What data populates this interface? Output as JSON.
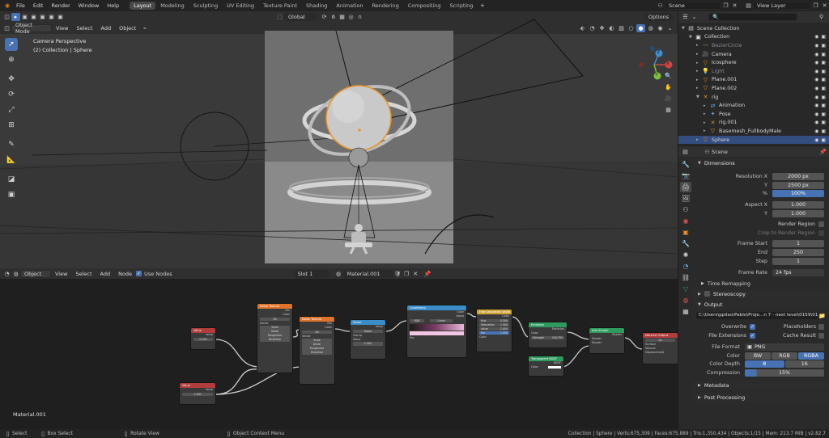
{
  "topbar": {
    "menus": [
      "File",
      "Edit",
      "Render",
      "Window",
      "Help"
    ],
    "workspaces": [
      {
        "label": "Layout",
        "active": true
      },
      {
        "label": "Modeling",
        "active": false
      },
      {
        "label": "Sculpting",
        "active": false
      },
      {
        "label": "UV Editing",
        "active": false
      },
      {
        "label": "Texture Paint",
        "active": false
      },
      {
        "label": "Shading",
        "active": false
      },
      {
        "label": "Animation",
        "active": false
      },
      {
        "label": "Rendering",
        "active": false
      },
      {
        "label": "Compositing",
        "active": false
      },
      {
        "label": "Scripting",
        "active": false
      }
    ],
    "scene": "Scene",
    "view_layer": "View Layer"
  },
  "viewport_header": {
    "transform_orientation": "Global",
    "options": "Options"
  },
  "viewport": {
    "mode": "Object Mode",
    "menus": [
      "View",
      "Select",
      "Add",
      "Object"
    ],
    "camera_label": "Camera Perspective",
    "object_label": "(2) Collection | Sphere",
    "gizmo": {
      "x": "X",
      "y": "Y",
      "z": "Z"
    }
  },
  "node_editor": {
    "type": "Object",
    "menus": [
      "View",
      "Select",
      "Add",
      "Node"
    ],
    "use_nodes": "Use Nodes",
    "slot": "Slot 1",
    "material": "Material.001",
    "material_label": "Material.001",
    "nodes": {
      "value1": {
        "title": "Value",
        "out": "Value",
        "val": "0.330"
      },
      "value2": {
        "title": "Value",
        "out": "Value",
        "val": "1.000"
      },
      "noise1": {
        "title": "Noise Texture",
        "rows": [
          "Fac",
          "Color"
        ],
        "dim": "3D",
        "inputs": [
          "Vector",
          "Scale",
          "Detail",
          "Roughness",
          "Distortion"
        ]
      },
      "noise2": {
        "title": "Noise Texture",
        "rows": [
          "Fac",
          "Color"
        ],
        "dim": "3D",
        "inputs": [
          "Vector",
          "Scale",
          "Detail",
          "Roughness",
          "Distortion"
        ]
      },
      "power": {
        "title": "Power",
        "out": "Value",
        "op": "Power",
        "clamp": "Clamp",
        "inputs": [
          "Value",
          "Value"
        ],
        "val": "1.000"
      },
      "ramp": {
        "title": "ColorRamp",
        "outs": [
          "Color",
          "Alpha"
        ],
        "mode": "RGB",
        "interp": "Linear",
        "fac": "Fac"
      },
      "hsv": {
        "title": "Hue Saturation Value",
        "out": "Color",
        "inputs": [
          "Hue",
          "Saturation",
          "Value",
          "Fac",
          "Color"
        ],
        "vals": [
          "0.500",
          "1.000",
          "1.000",
          "1.000"
        ]
      },
      "emission": {
        "title": "Emission",
        "out": "Emission",
        "inputs": [
          "Color",
          "Strength"
        ],
        "strength": "100.700"
      },
      "transparent": {
        "title": "Transparent BSDF",
        "out": "BSDF",
        "inputs": [
          "Color"
        ]
      },
      "add": {
        "title": "Add Shader",
        "out": "Shader",
        "inputs": [
          "Shader",
          "Shader"
        ]
      },
      "output": {
        "title": "Material Output",
        "target": "All",
        "inputs": [
          "Surface",
          "Volume",
          "Displacement"
        ]
      }
    }
  },
  "outliner": {
    "items": [
      {
        "label": "Scene Collection",
        "depth": 0,
        "icon": "scene-collection-icon"
      },
      {
        "label": "Collection",
        "depth": 1,
        "icon": "collection-icon"
      },
      {
        "label": "BezierCircle",
        "depth": 2,
        "icon": "curve-icon"
      },
      {
        "label": "Camera",
        "depth": 2,
        "icon": "camera-icon"
      },
      {
        "label": "Icosphere",
        "depth": 2,
        "icon": "mesh-icon"
      },
      {
        "label": "Light",
        "depth": 2,
        "icon": "light-icon"
      },
      {
        "label": "Plane.001",
        "depth": 2,
        "icon": "mesh-icon"
      },
      {
        "label": "Plane.002",
        "depth": 2,
        "icon": "mesh-icon"
      },
      {
        "label": "rig",
        "depth": 2,
        "icon": "armature-icon"
      },
      {
        "label": "Animation",
        "depth": 3,
        "icon": "action-icon"
      },
      {
        "label": "Pose",
        "depth": 3,
        "icon": "pose-icon"
      },
      {
        "label": "rig.001",
        "depth": 3,
        "icon": "armature-icon"
      },
      {
        "label": "Basemesh_FullbodyMale",
        "depth": 3,
        "icon": "mesh-icon"
      },
      {
        "label": "Sphere",
        "depth": 2,
        "icon": "mesh-icon",
        "selected": true
      }
    ]
  },
  "properties": {
    "scene_name": "Scene",
    "dimensions": {
      "header": "Dimensions",
      "res_x_label": "Resolution X",
      "res_x": "2000 px",
      "res_y_label": "Y",
      "res_y": "2500 px",
      "pct_label": "%",
      "pct": "100%",
      "aspect_x_label": "Aspect X",
      "aspect_x": "1.000",
      "aspect_y_label": "Y",
      "aspect_y": "1.000",
      "render_region": "Render Region",
      "crop": "Crop to Render Region",
      "frame_start_label": "Frame Start",
      "frame_start": "1",
      "end_label": "End",
      "end": "250",
      "step_label": "Step",
      "step": "1",
      "frame_rate_label": "Frame Rate",
      "frame_rate": "24 fps",
      "time_remapping": "Time Remapping"
    },
    "stereoscopy": "Stereoscopy",
    "output": {
      "header": "Output",
      "path": "C:\\Users\\ppilao\\Pablo\\Proje...n 7 - next level\\0159\\0159",
      "overwrite": "Overwrite",
      "placeholders": "Placeholders",
      "file_extensions": "File Extensions",
      "cache_result": "Cache Result",
      "file_format_label": "File Format",
      "file_format": "PNG",
      "color_label": "Color",
      "color_opts": [
        "BW",
        "RGB",
        "RGBA"
      ],
      "color_depth_label": "Color Depth",
      "depth_opts": [
        "8",
        "16"
      ],
      "compression_label": "Compression",
      "compression": "15%"
    },
    "metadata": "Metadata",
    "post_processing": "Post Processing"
  },
  "statusbar": {
    "select": "Select",
    "box_select": "Box Select",
    "rotate_view": "Rotate View",
    "context_menu": "Object Context Menu",
    "stats": "Collection | Sphere | Verts:675,309 | Faces:675,889 | Tris:1,350,434 | Objects:1/15 | Mem: 213.7 MiB | v2.82.7"
  },
  "colors": {
    "accent": "#4772b3",
    "selected_row": "#334d80",
    "origin_orange": "#e8931f",
    "node_input": "#b03c3c",
    "node_texture": "#e0732b",
    "node_converter": "#3a8dc7",
    "node_color": "#cfa33a",
    "node_shader": "#2e9a5e"
  }
}
